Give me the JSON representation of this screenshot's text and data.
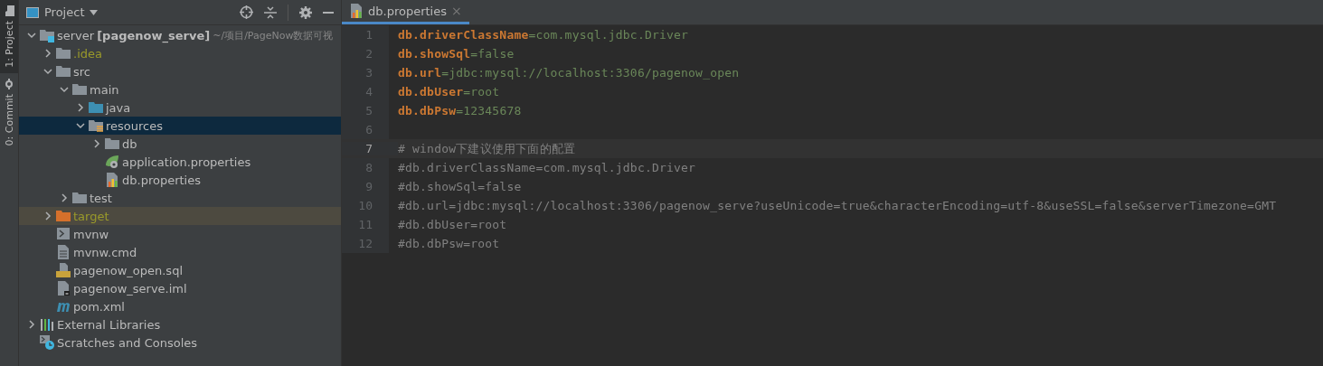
{
  "side_strip": [
    {
      "label": "1: Project",
      "selected": true,
      "kind": "folder"
    },
    {
      "label": "0: Commit",
      "selected": false,
      "kind": "commit"
    }
  ],
  "project_panel": {
    "title": "Project",
    "tree": [
      {
        "label": "server",
        "module": "[pagenow_serve]",
        "path": "~/项目/PageNow数据可视",
        "kind": "module",
        "expanded": true,
        "selected": false,
        "ignored": false,
        "excluded": false,
        "children": [
          {
            "label": ".idea",
            "kind": "folder",
            "expanded": false,
            "selected": false,
            "ignored": true,
            "excluded": false
          },
          {
            "label": "src",
            "kind": "folder",
            "expanded": true,
            "selected": false,
            "ignored": false,
            "excluded": false,
            "children": [
              {
                "label": "main",
                "kind": "folder",
                "expanded": true,
                "selected": false,
                "ignored": false,
                "excluded": false,
                "children": [
                  {
                    "label": "java",
                    "kind": "source",
                    "expanded": false,
                    "selected": false,
                    "ignored": false,
                    "excluded": false
                  },
                  {
                    "label": "resources",
                    "kind": "resources",
                    "expanded": true,
                    "selected": true,
                    "ignored": false,
                    "excluded": false,
                    "children": [
                      {
                        "label": "db",
                        "kind": "folder",
                        "expanded": false,
                        "selected": false,
                        "ignored": false,
                        "excluded": false
                      },
                      {
                        "label": "application.properties",
                        "kind": "spring",
                        "selected": false,
                        "ignored": false,
                        "excluded": false
                      },
                      {
                        "label": "db.properties",
                        "kind": "properties",
                        "selected": false,
                        "ignored": false,
                        "excluded": false
                      }
                    ]
                  }
                ]
              },
              {
                "label": "test",
                "kind": "folder",
                "expanded": false,
                "selected": false,
                "ignored": false,
                "excluded": false
              }
            ]
          },
          {
            "label": "target",
            "kind": "folder",
            "expanded": false,
            "selected": false,
            "ignored": false,
            "excluded": true
          },
          {
            "label": "mvnw",
            "kind": "exec",
            "selected": false,
            "ignored": false,
            "excluded": false
          },
          {
            "label": "mvnw.cmd",
            "kind": "text",
            "selected": false,
            "ignored": false,
            "excluded": false
          },
          {
            "label": "pagenow_open.sql",
            "kind": "sql",
            "selected": false,
            "ignored": false,
            "excluded": false
          },
          {
            "label": "pagenow_serve.iml",
            "kind": "iml",
            "selected": false,
            "ignored": false,
            "excluded": false
          },
          {
            "label": "pom.xml",
            "kind": "maven",
            "selected": false,
            "ignored": false,
            "excluded": false
          }
        ]
      },
      {
        "label": "External Libraries",
        "kind": "libraries",
        "expanded": false,
        "selected": false,
        "ignored": false,
        "excluded": false
      },
      {
        "label": "Scratches and Consoles",
        "kind": "scratches",
        "selected": false,
        "ignored": false,
        "excluded": false
      }
    ]
  },
  "editor": {
    "tabs": [
      {
        "label": "db.properties",
        "close": "×",
        "selected": true
      }
    ],
    "lines": [
      {
        "number": "1",
        "kind": "property",
        "key": "db.driverClassName",
        "separator": "=",
        "value": "com.mysql.jdbc.Driver",
        "current": false
      },
      {
        "number": "2",
        "kind": "property",
        "key": "db.showSql",
        "separator": "=",
        "value": "false",
        "current": false
      },
      {
        "number": "3",
        "kind": "property",
        "key": "db.url",
        "separator": "=",
        "value": "jdbc:mysql://localhost:3306/pagenow_open",
        "current": false
      },
      {
        "number": "4",
        "kind": "property",
        "key": "db.dbUser",
        "separator": "=",
        "value": "root",
        "current": false
      },
      {
        "number": "5",
        "kind": "property",
        "key": "db.dbPsw",
        "separator": "=",
        "value": "12345678",
        "current": false
      },
      {
        "number": "6",
        "kind": "blank",
        "current": false
      },
      {
        "number": "7",
        "kind": "comment",
        "text": "# window下建议使用下面的配置",
        "current": true
      },
      {
        "number": "8",
        "kind": "comment",
        "text": "#db.driverClassName=com.mysql.jdbc.Driver",
        "current": false
      },
      {
        "number": "9",
        "kind": "comment",
        "text": "#db.showSql=false",
        "current": false
      },
      {
        "number": "10",
        "kind": "comment",
        "text": "#db.url=jdbc:mysql://localhost:3306/pagenow_serve?useUnicode=true&characterEncoding=utf-8&useSSL=false&serverTimezone=GMT",
        "current": false
      },
      {
        "number": "11",
        "kind": "comment",
        "text": "#db.dbUser=root",
        "current": false
      },
      {
        "number": "12",
        "kind": "comment",
        "text": "#db.dbPsw=root",
        "current": false
      }
    ]
  }
}
